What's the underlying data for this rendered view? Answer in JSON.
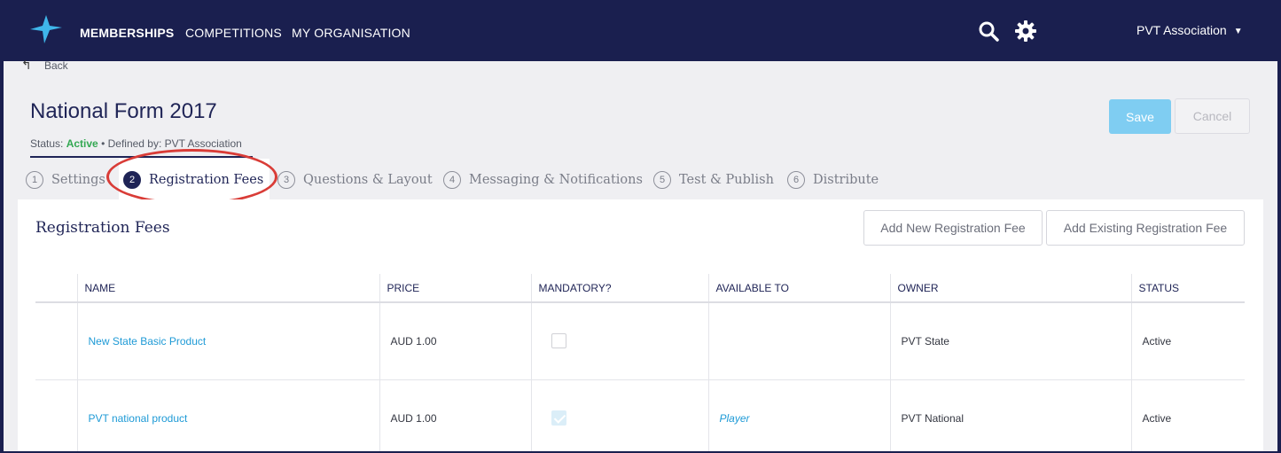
{
  "nav": {
    "items": [
      {
        "label": "MEMBERSHIPS",
        "active": true
      },
      {
        "label": "COMPETITIONS",
        "active": false
      },
      {
        "label": "MY ORGANISATION",
        "active": false
      }
    ],
    "icons": [
      "search-icon",
      "gear-icon"
    ],
    "org_name": "PVT Association",
    "caret": "▼"
  },
  "page": {
    "back_label": "Back",
    "title": "National Form 2017",
    "status_prefix": "Status:",
    "status_value": "Active",
    "defined_by": "• Defined by: PVT Association",
    "save_label": "Save",
    "cancel_label": "Cancel"
  },
  "steps": [
    {
      "num": "1",
      "label": "Settings"
    },
    {
      "num": "2",
      "label": "Registration Fees",
      "current": true
    },
    {
      "num": "3",
      "label": "Questions & Layout"
    },
    {
      "num": "4",
      "label": "Messaging & Notifications"
    },
    {
      "num": "5",
      "label": "Test & Publish"
    },
    {
      "num": "6",
      "label": "Distribute"
    }
  ],
  "panel": {
    "title": "Registration Fees",
    "add_new_label": "Add New Registration Fee",
    "add_existing_label": "Add Existing Registration Fee",
    "columns": [
      "",
      "NAME",
      "PRICE",
      "MANDATORY?",
      "AVAILABLE TO",
      "OWNER",
      "STATUS"
    ],
    "rows": [
      {
        "name": "New State Basic Product",
        "price": "AUD 1.00",
        "mandatory": false,
        "available_to": "",
        "owner": "PVT State",
        "status": "Active"
      },
      {
        "name": "PVT national product",
        "price": "AUD 1.00",
        "mandatory": true,
        "available_to": "Player",
        "owner": "PVT National",
        "status": "Active"
      }
    ]
  },
  "colors": {
    "navbar": "#1a1f4f",
    "accent_link": "#1e9ad6",
    "status_active": "#33a852",
    "highlight_circle": "#d93c37",
    "save_button": "#7fcdf2"
  }
}
